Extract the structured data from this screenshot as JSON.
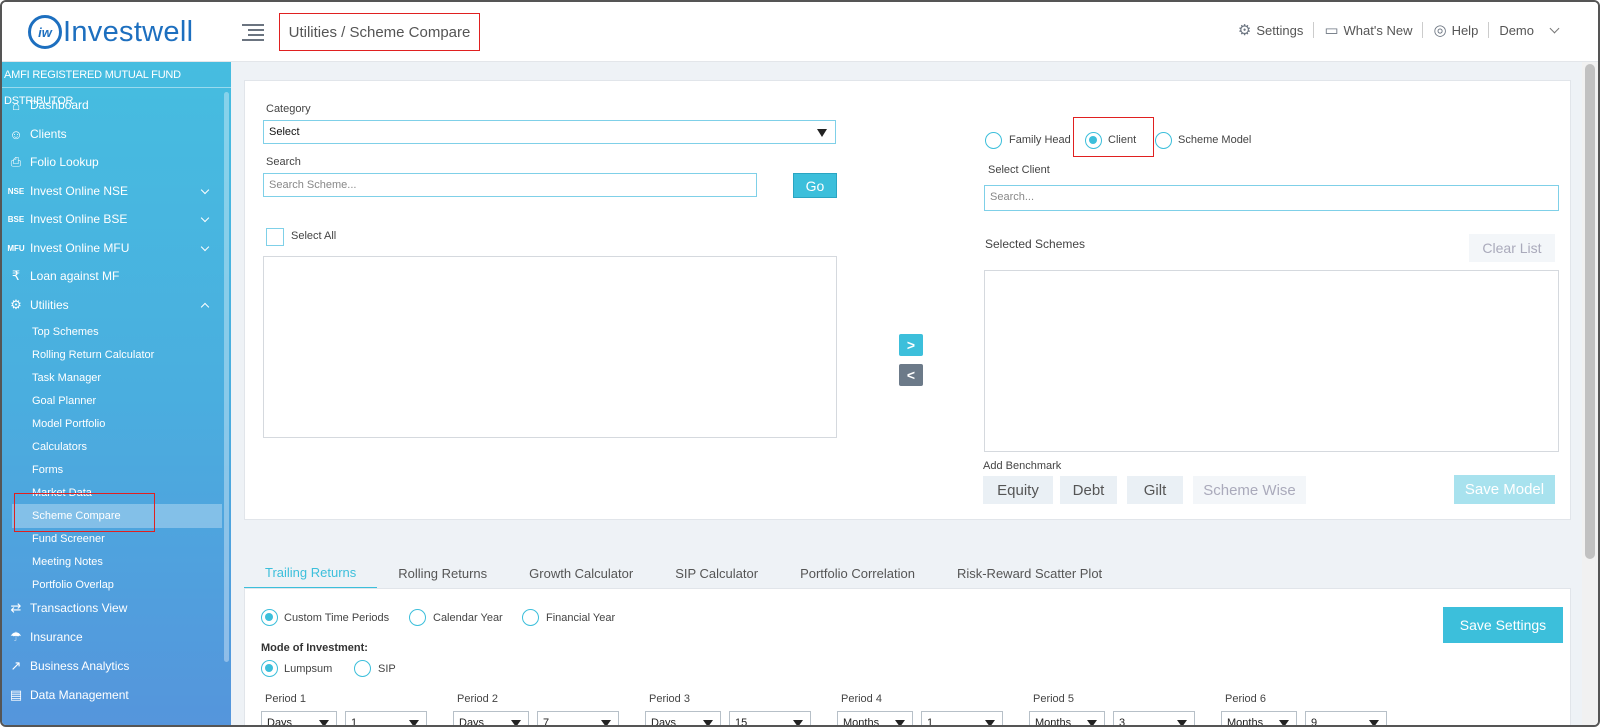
{
  "header": {
    "logo_mark": "iw",
    "logo_text": "Investwell",
    "breadcrumb": "Utilities / Scheme Compare",
    "nav": {
      "settings": "Settings",
      "whats_new": "What's New",
      "help": "Help",
      "user": "Demo"
    }
  },
  "sidebar": {
    "amfi": "AMFI REGISTERED MUTUAL FUND DSTRIBUTOR",
    "items": [
      {
        "icon": "home-icon",
        "glyph": "⌂",
        "label": "Dashboard"
      },
      {
        "icon": "users-icon",
        "glyph": "☺",
        "label": "Clients"
      },
      {
        "icon": "folio-icon",
        "glyph": "⎙",
        "label": "Folio Lookup"
      },
      {
        "icon": "nse-badge-icon",
        "glyph": "NSE",
        "label": "Invest Online NSE"
      },
      {
        "icon": "bse-badge-icon",
        "glyph": "BSE",
        "label": "Invest Online BSE"
      },
      {
        "icon": "mfu-badge-icon",
        "glyph": "MFU",
        "label": "Invest Online MFU"
      },
      {
        "icon": "loan-icon",
        "glyph": "₹",
        "label": "Loan against MF"
      },
      {
        "icon": "utilities-icon",
        "glyph": "⚙",
        "label": "Utilities"
      }
    ],
    "sub_items": [
      "Top Schemes",
      "Rolling Return Calculator",
      "Task Manager",
      "Goal Planner",
      "Model Portfolio",
      "Calculators",
      "Forms",
      "Market Data",
      "Scheme Compare",
      "Fund Screener",
      "Meeting Notes",
      "Portfolio Overlap"
    ],
    "bottom_items": [
      {
        "icon": "transactions-icon",
        "glyph": "⇄",
        "label": "Transactions View"
      },
      {
        "icon": "insurance-icon",
        "glyph": "☂",
        "label": "Insurance"
      },
      {
        "icon": "analytics-icon",
        "glyph": "↗",
        "label": "Business Analytics"
      },
      {
        "icon": "data-icon",
        "glyph": "▤",
        "label": "Data Management"
      }
    ]
  },
  "left": {
    "category_label": "Category",
    "category_value": "Select",
    "search_label": "Search",
    "search_placeholder": "Search Scheme...",
    "go_label": "Go",
    "select_all_label": "Select All"
  },
  "move": {
    "add": ">",
    "remove": "<"
  },
  "right": {
    "radio_family": "Family Head",
    "radio_client": "Client",
    "radio_model": "Scheme Model",
    "select_client_label": "Select Client",
    "client_placeholder": "Search...",
    "selected_schemes_label": "Selected Schemes",
    "clear_list": "Clear List",
    "add_benchmark_label": "Add Benchmark",
    "benchmarks": [
      "Equity",
      "Debt",
      "Gilt",
      "Scheme Wise"
    ],
    "save_model": "Save Model"
  },
  "tabs": [
    "Trailing Returns",
    "Rolling Returns",
    "Growth Calculator",
    "SIP Calculator",
    "Portfolio Correlation",
    "Risk-Reward Scatter Plot"
  ],
  "returns": {
    "period_types": [
      "Custom Time Periods",
      "Calendar Year",
      "Financial Year"
    ],
    "mode_label": "Mode of Investment:",
    "modes": [
      "Lumpsum",
      "SIP"
    ],
    "save_settings": "Save Settings",
    "periods": [
      {
        "label": "Period 1",
        "unit": "Days",
        "value": "1"
      },
      {
        "label": "Period 2",
        "unit": "Days",
        "value": "7"
      },
      {
        "label": "Period 3",
        "unit": "Days",
        "value": "15"
      },
      {
        "label": "Period 4",
        "unit": "Months",
        "value": "1"
      },
      {
        "label": "Period 5",
        "unit": "Months",
        "value": "3"
      },
      {
        "label": "Period 6",
        "unit": "Months",
        "value": "9"
      }
    ]
  },
  "colors": {
    "accent": "#3cbfdb",
    "brand": "#1d6fbf",
    "highlight": "#e02020"
  }
}
